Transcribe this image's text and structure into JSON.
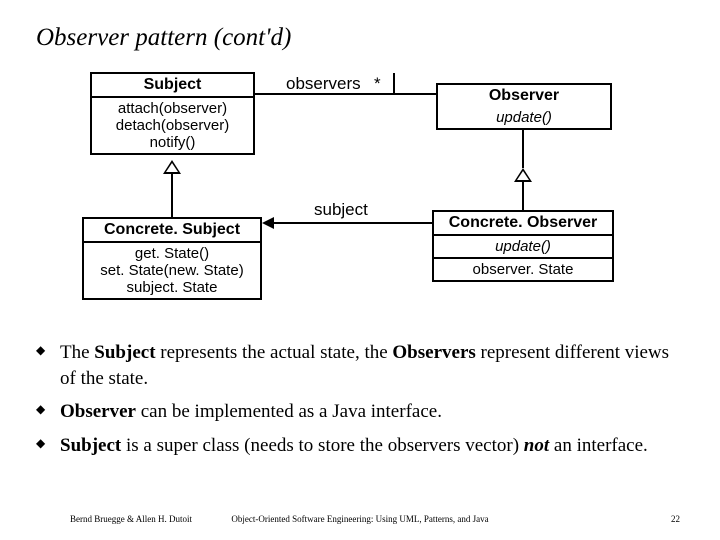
{
  "title": "Observer pattern (cont'd)",
  "uml": {
    "subject": {
      "name": "Subject",
      "ops": [
        "attach(observer)",
        "detach(observer)",
        "notify()"
      ]
    },
    "observer": {
      "name": "Observer",
      "ops": [
        "update()"
      ]
    },
    "concreteSubject": {
      "name": "Concrete. Subject",
      "ops": [
        "get. State()",
        "set. State(new. State)",
        "subject. State"
      ]
    },
    "concreteObserver": {
      "name": "Concrete. Observer",
      "ops": [
        "update()"
      ],
      "attrs": [
        "observer. State"
      ]
    },
    "assoc": {
      "observers": "observers",
      "star": "*",
      "subject": "subject"
    }
  },
  "bullets": [
    {
      "pre": "The ",
      "b1": "Subject",
      "mid": " represents the actual state, the ",
      "b2": "Observers",
      "post": " represent different views of the state."
    },
    {
      "b1": "Observer",
      "post": " can  be implemented as a Java interface."
    },
    {
      "b1": "Subject",
      "mid": " is a super class (needs to store the observers vector) ",
      "b2i": "not",
      "post": " an interface."
    }
  ],
  "footer": {
    "left": "Bernd Bruegge & Allen H. Dutoit",
    "center": "Object-Oriented Software Engineering: Using UML, Patterns, and Java",
    "right": "22"
  }
}
